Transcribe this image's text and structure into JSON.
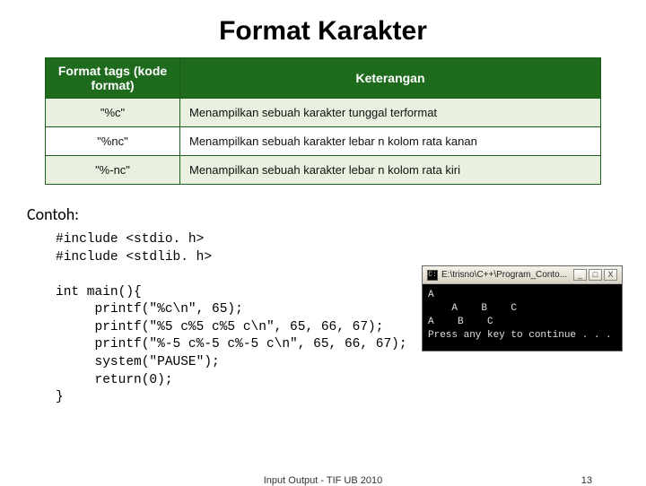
{
  "title": "Format Karakter",
  "table": {
    "headers": [
      "Format tags\n(kode format)",
      "Keterangan"
    ],
    "rows": [
      {
        "code": "\"%c\"",
        "desc": "Menampilkan sebuah karakter tunggal terformat"
      },
      {
        "code": "\"%nc\"",
        "desc": "Menampilkan sebuah karakter lebar n kolom rata kanan"
      },
      {
        "code": "\"%-nc\"",
        "desc": "Menampilkan sebuah karakter lebar n kolom rata kiri"
      }
    ]
  },
  "contoh_label": "Contoh:",
  "code_block": "#include <stdio. h>\n#include <stdlib. h>\n\nint main(){\n     printf(\"%c\\n\", 65);\n     printf(\"%5 c%5 c%5 c\\n\", 65, 66, 67);\n     printf(\"%-5 c%-5 c%-5 c\\n\", 65, 66, 67);\n     system(\"PAUSE\");\n     return(0);\n}",
  "console": {
    "title": "E:\\trisno\\C++\\Program_Conto...",
    "buttons": {
      "min": "_",
      "max": "□",
      "close": "X"
    },
    "output": "A\n    A    B    C\nA    B    C\nPress any key to continue . . ."
  },
  "footer": {
    "center": "Input Output - TIF UB 2010",
    "page": "13"
  }
}
